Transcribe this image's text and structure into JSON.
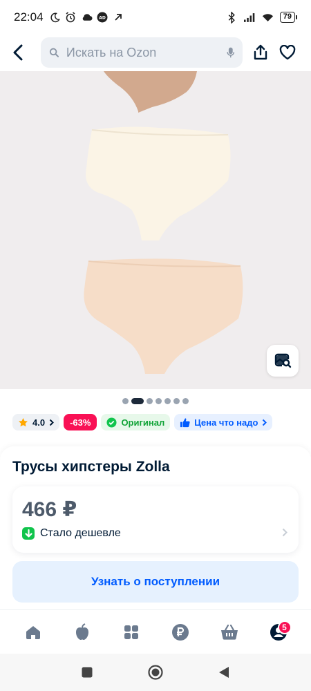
{
  "status_bar": {
    "time": "22:04",
    "battery": "79"
  },
  "search": {
    "placeholder": "Искать на Ozon"
  },
  "gallery": {
    "dots_count": 7,
    "active_index": 1
  },
  "chips": {
    "rating": "4.0",
    "discount": "-63%",
    "original": "Оригинал",
    "price_check": "Цена что надо"
  },
  "product": {
    "title": "Трусы хипстеры Zolla",
    "price": "466 ₽",
    "cheaper_label": "Стало дешевле"
  },
  "notify_button": "Узнать о поступлении",
  "tabbar": {
    "profile_badge": "5"
  },
  "colors": {
    "brand_blue": "#005bff",
    "discount_pink": "#f91155",
    "success_green": "#10c44c"
  }
}
